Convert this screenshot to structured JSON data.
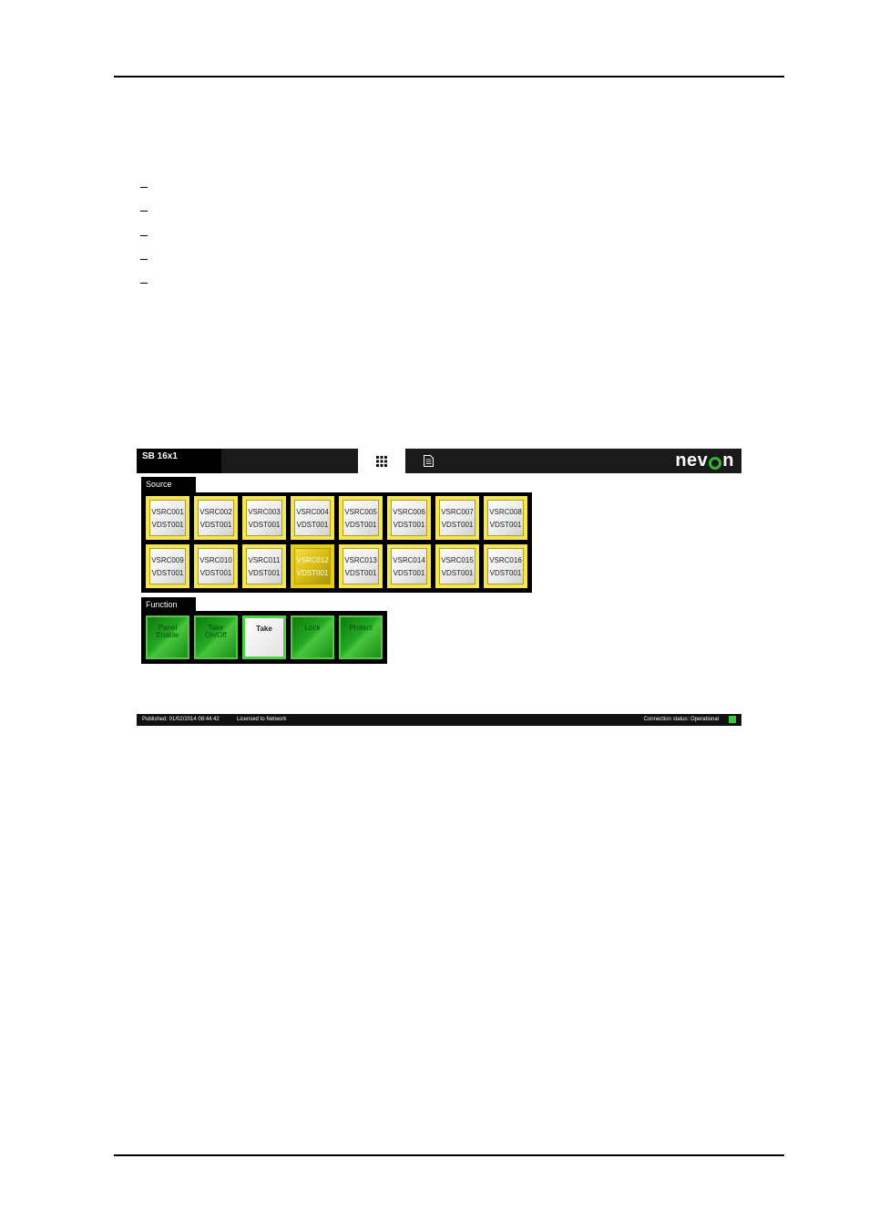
{
  "panel": {
    "name": "SB 16x1",
    "tabs": [
      {
        "icon": "grid-icon"
      },
      {
        "icon": "document-icon"
      }
    ],
    "logo": {
      "left": "nev",
      "right": "n"
    },
    "colors": {
      "accent": "#34b233",
      "source_border": "#f3e55a",
      "selected": "#d9bd12",
      "function": "#22a824"
    }
  },
  "source": {
    "label": "Source",
    "buttons": [
      {
        "line1": "VSRC001",
        "line2": "VDST001"
      },
      {
        "line1": "VSRC002",
        "line2": "VDST001"
      },
      {
        "line1": "VSRC003",
        "line2": "VDST001"
      },
      {
        "line1": "VSRC004",
        "line2": "VDST001"
      },
      {
        "line1": "VSRC005",
        "line2": "VDST001"
      },
      {
        "line1": "VSRC006",
        "line2": "VDST001"
      },
      {
        "line1": "VSRC007",
        "line2": "VDST001"
      },
      {
        "line1": "VSRC008",
        "line2": "VDST001"
      },
      {
        "line1": "VSRC009",
        "line2": "VDST001"
      },
      {
        "line1": "VSRC010",
        "line2": "VDST001"
      },
      {
        "line1": "VSRC011",
        "line2": "VDST001"
      },
      {
        "line1": "VSRC012",
        "line2": "VDST001"
      },
      {
        "line1": "VSRC013",
        "line2": "VDST001"
      },
      {
        "line1": "VSRC014",
        "line2": "VDST001"
      },
      {
        "line1": "VSRC015",
        "line2": "VDST001"
      },
      {
        "line1": "VSRC016",
        "line2": "VDST001"
      }
    ],
    "selected": "VSRC012"
  },
  "function": {
    "label": "Function",
    "buttons": [
      {
        "line1": "Panel",
        "line2": "Enable"
      },
      {
        "line1": "Take",
        "line2": "On/Off"
      },
      {
        "line1": "Take",
        "line2": ""
      },
      {
        "line1": "Lock",
        "line2": ""
      },
      {
        "line1": "Protect",
        "line2": ""
      }
    ],
    "active": "Take"
  },
  "status": {
    "published": "Published: 01/02/2014 08:44:42",
    "license": "Licensed to Network",
    "connection": "Connection status: Operational"
  }
}
